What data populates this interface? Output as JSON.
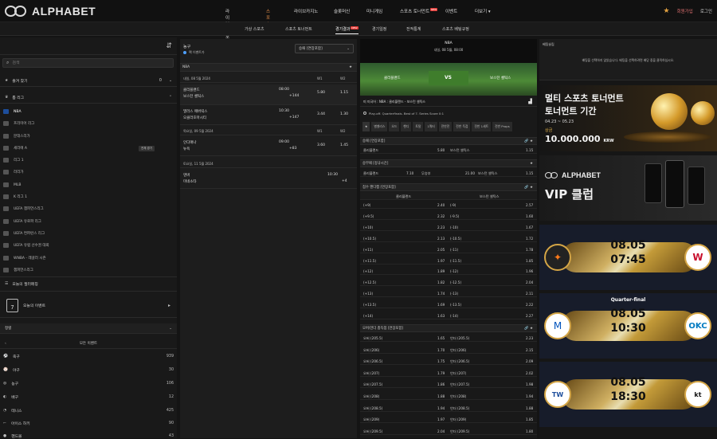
{
  "brand": {
    "name": "ALPHABET"
  },
  "topnav": {
    "items": [
      "라이브스포츠",
      "스포츠",
      "라이브카지노",
      "슬롯머신",
      "미니게임",
      "스포츠 토너먼트",
      "이벤트",
      "더보기 ▾"
    ],
    "new_badge": "NEW",
    "join": "회원가입",
    "login": "로그인"
  },
  "subnav": {
    "items": [
      "가상 스포츠",
      "스포츠 토너먼트",
      "경기결과",
      "경기일정",
      "전적통계",
      "스포츠 베팅규정"
    ]
  },
  "left": {
    "search_placeholder": "검색",
    "favorites": "즐겨 찾기",
    "favorites_count": "0",
    "top_leagues": "톱 리그",
    "leagues": [
      "NBA",
      "프리미어 리그",
      "분데스리가",
      "세리에 A",
      "리그 1",
      "라리가",
      "MLB",
      "K 리그 1",
      "UEFA 챔피언스리그",
      "UEFA 유로파 리그",
      "UEFA 컨퍼런스 리그",
      "UEFA 유럽 선수권 대회",
      "WNBA - 레귤러 시즌",
      "챔피언스리그"
    ],
    "league_pill": "전체 경기",
    "today": "오늘의 필터메칭",
    "events_label": "오늘의 이벤트",
    "calendar_day": "7",
    "filter": "정렬",
    "all_events": "모든 이벤트",
    "sports": [
      {
        "name": "축구",
        "count": "939"
      },
      {
        "name": "야구",
        "count": "30"
      },
      {
        "name": "농구",
        "count": "106"
      },
      {
        "name": "배구",
        "count": "12"
      },
      {
        "name": "테니스",
        "count": "425"
      },
      {
        "name": "아이스 하키",
        "count": "90"
      },
      {
        "name": "핸드볼",
        "count": "43"
      }
    ]
  },
  "middle": {
    "sport": "농구",
    "live": "팩 이벤트가",
    "select": "승패 [연장포함]",
    "league": "NBA",
    "date1": "내일, 08 5월 2024",
    "col1": "W1",
    "col2": "W2",
    "matches": [
      {
        "t1": "클리블랜드",
        "t2": "보스턴 셀틱스",
        "time": "08:00",
        "more": "+144",
        "o1": "5.80",
        "o2": "1.15"
      },
      {
        "t1": "댈러스 매버릭스",
        "t2": "오클라호마시티",
        "time": "10:30",
        "more": "+147",
        "o1": "3.44",
        "o2": "1.30"
      }
    ],
    "date2": "목요일, 09 5월 2024",
    "match3": {
      "t1": "인디애나",
      "t2": "뉴욕",
      "time": "09:00",
      "more": "+83",
      "o1": "3.60",
      "o2": "1.45"
    },
    "date3": "토요일, 11 5월 2024",
    "match4": {
      "t1": "덴버",
      "t2": "미네소타",
      "time": "10:30",
      "more": "+4"
    }
  },
  "center": {
    "league": "NBA",
    "datetime": "내일, 08 5월, 08:00",
    "team1": "클리블랜드",
    "team2": "보스턴 셀틱스",
    "vs": "VS",
    "title": "미 미국어 : NBA : 클리블랜드 - 보스턴 셀틱스",
    "info": "Play-off. Quarterfinals. Best of 7. Series Score 0:1",
    "tabs": [
      "별밸리스",
      "오드",
      "핸디",
      "토탈",
      "1쿼터",
      "전반전",
      "전반 득점",
      "전반 1세트",
      "전반 Props"
    ],
    "m1": "승패 [연장포함]",
    "m1_rows": [
      [
        "클리블랜드",
        "5.80",
        "보스턴 셀틱스",
        "1.15"
      ]
    ],
    "m2": "승무패 [정규시간]",
    "m2_rows": [
      [
        "클리블랜드",
        "7.10",
        "무승부",
        "21.00",
        "보스턴 셀틱스",
        "1.15"
      ]
    ],
    "m3": "점수 핸디캡 [연장포함]",
    "m3_head": [
      "클리블랜드",
      "보스턴 셀틱스"
    ],
    "m3_rows": [
      [
        "(+9)",
        "2.40",
        "(-9)",
        "2.57"
      ],
      [
        "(+9.5)",
        "2.32",
        "(-9.5)",
        "1.60"
      ],
      [
        "(+10)",
        "2.23",
        "(-10)",
        "1.67"
      ],
      [
        "(+10.5)",
        "2.13",
        "(-10.5)",
        "1.72"
      ],
      [
        "(+11)",
        "2.05",
        "(-11)",
        "1.78"
      ],
      [
        "(+11.5)",
        "1.97",
        "(-11.5)",
        "1.85"
      ],
      [
        "(+12)",
        "1.89",
        "(-12)",
        "1.96"
      ],
      [
        "(+12.5)",
        "1.82",
        "(-12.5)",
        "2.04"
      ],
      [
        "(+13)",
        "1.74",
        "(-13)",
        "2.11"
      ],
      [
        "(+13.5)",
        "1.69",
        "(-13.5)",
        "2.22"
      ],
      [
        "(+14)",
        "1.63",
        "(-14)",
        "2.27"
      ]
    ],
    "m4": "오버/언더 총득점 [연장포함]",
    "m4_rows": [
      [
        "오버 (205.5)",
        "1.65",
        "언더 (205.5)",
        "2.23"
      ],
      [
        "오버 (206)",
        "1.70",
        "언더 (206)",
        "2.15"
      ],
      [
        "오버 (206.5)",
        "1.75",
        "언더 (206.5)",
        "2.09"
      ],
      [
        "오버 (207)",
        "1.79",
        "언더 (207)",
        "2.02"
      ],
      [
        "오버 (207.5)",
        "1.86",
        "언더 (207.5)",
        "1.98"
      ],
      [
        "오버 (208)",
        "1.88",
        "언더 (208)",
        "1.94"
      ],
      [
        "오버 (208.5)",
        "1.94",
        "언더 (208.5)",
        "1.88"
      ],
      [
        "오버 (209)",
        "1.97",
        "언더 (209)",
        "1.85"
      ],
      [
        "오버 (209.5)",
        "2.04",
        "언더 (209.5)",
        "1.80"
      ]
    ]
  },
  "betslip": {
    "title": "베팅슬립",
    "empty": "배팅을 선택하지 않았습니다. 배팅을 선택하려면 배당 중을 클릭하십시오."
  },
  "banners": {
    "b1_title": "멀티 스포츠 토너먼트",
    "b1_sub": "토너먼트 기간",
    "b1_dates": "04.23 ~ 05.23",
    "b1_prize_label": "상금",
    "b1_prize": "10.000.000",
    "b1_cur": "KRW",
    "b2_brand": "ALPHABET",
    "b2_title": "VIP 클럽",
    "g1_date": "08.05",
    "g1_time": "07:45",
    "g2_label": "Quarter-final",
    "g2_date": "08.05",
    "g2_time": "10:30",
    "g3_date": "08.05",
    "g3_time": "18:30"
  }
}
